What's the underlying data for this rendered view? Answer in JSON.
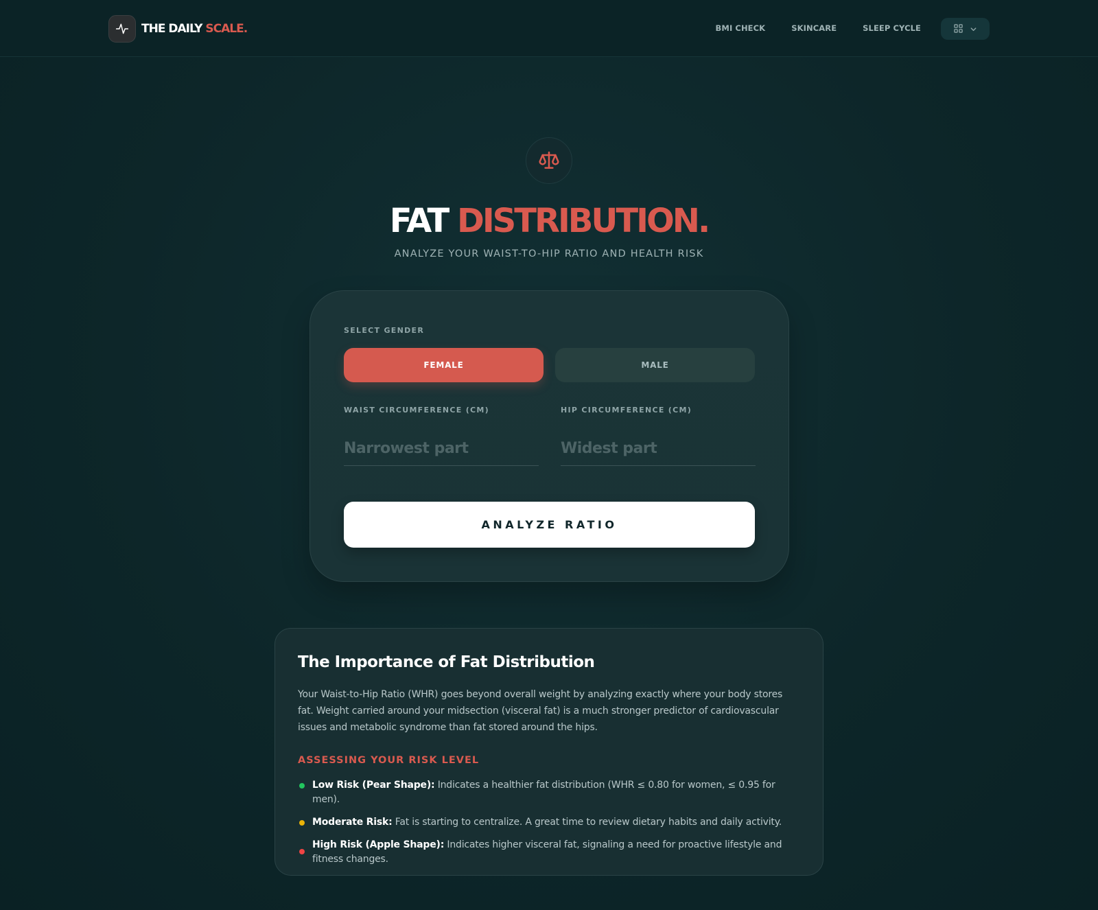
{
  "brand": {
    "name_white": "THE DAILY",
    "name_red": "SCALE.",
    "icon": "activity-pulse-icon"
  },
  "nav": {
    "links": [
      "BMI CHECK",
      "SKINCARE",
      "SLEEP CYCLE"
    ],
    "apps_menu_icon": "grid-icon"
  },
  "hero": {
    "icon": "scales-icon",
    "title_white": "FAT",
    "title_red": "DISTRIBUTION.",
    "subtitle": "ANALYZE YOUR WAIST-TO-HIP RATIO AND HEALTH RISK"
  },
  "form": {
    "gender_label": "SELECT GENDER",
    "gender_options": [
      "FEMALE",
      "MALE"
    ],
    "selected_gender": "FEMALE",
    "waist_label": "WAIST CIRCUMFERENCE (CM)",
    "waist_placeholder": "Narrowest part",
    "waist_value": "",
    "hip_label": "HIP CIRCUMFERENCE (CM)",
    "hip_placeholder": "Widest part",
    "hip_value": "",
    "submit_label": "ANALYZE RATIO"
  },
  "info": {
    "title": "The Importance of Fat Distribution",
    "body": "Your Waist-to-Hip Ratio (WHR) goes beyond overall weight by analyzing exactly where your body stores fat. Weight carried around your midsection (visceral fat) is a much stronger predictor of cardiovascular issues and metabolic syndrome than fat stored around the hips.",
    "subheading": "ASSESSING YOUR RISK LEVEL",
    "risks": [
      {
        "label": "Low Risk (Pear Shape):",
        "text": "Indicates a healthier fat distribution (WHR ≤ 0.80 for women, ≤ 0.95 for men).",
        "color": "#22c55e"
      },
      {
        "label": "Moderate Risk:",
        "text": "Fat is starting to centralize. A great time to review dietary habits and daily activity.",
        "color": "#eab308"
      },
      {
        "label": "High Risk (Apple Shape):",
        "text": "Indicates higher visceral fat, signaling a need for proactive lifestyle and fitness changes.",
        "color": "#ef4444"
      }
    ]
  },
  "colors": {
    "accent": "#d95a4f",
    "background": "#0d2629",
    "card": "#1a3336"
  }
}
